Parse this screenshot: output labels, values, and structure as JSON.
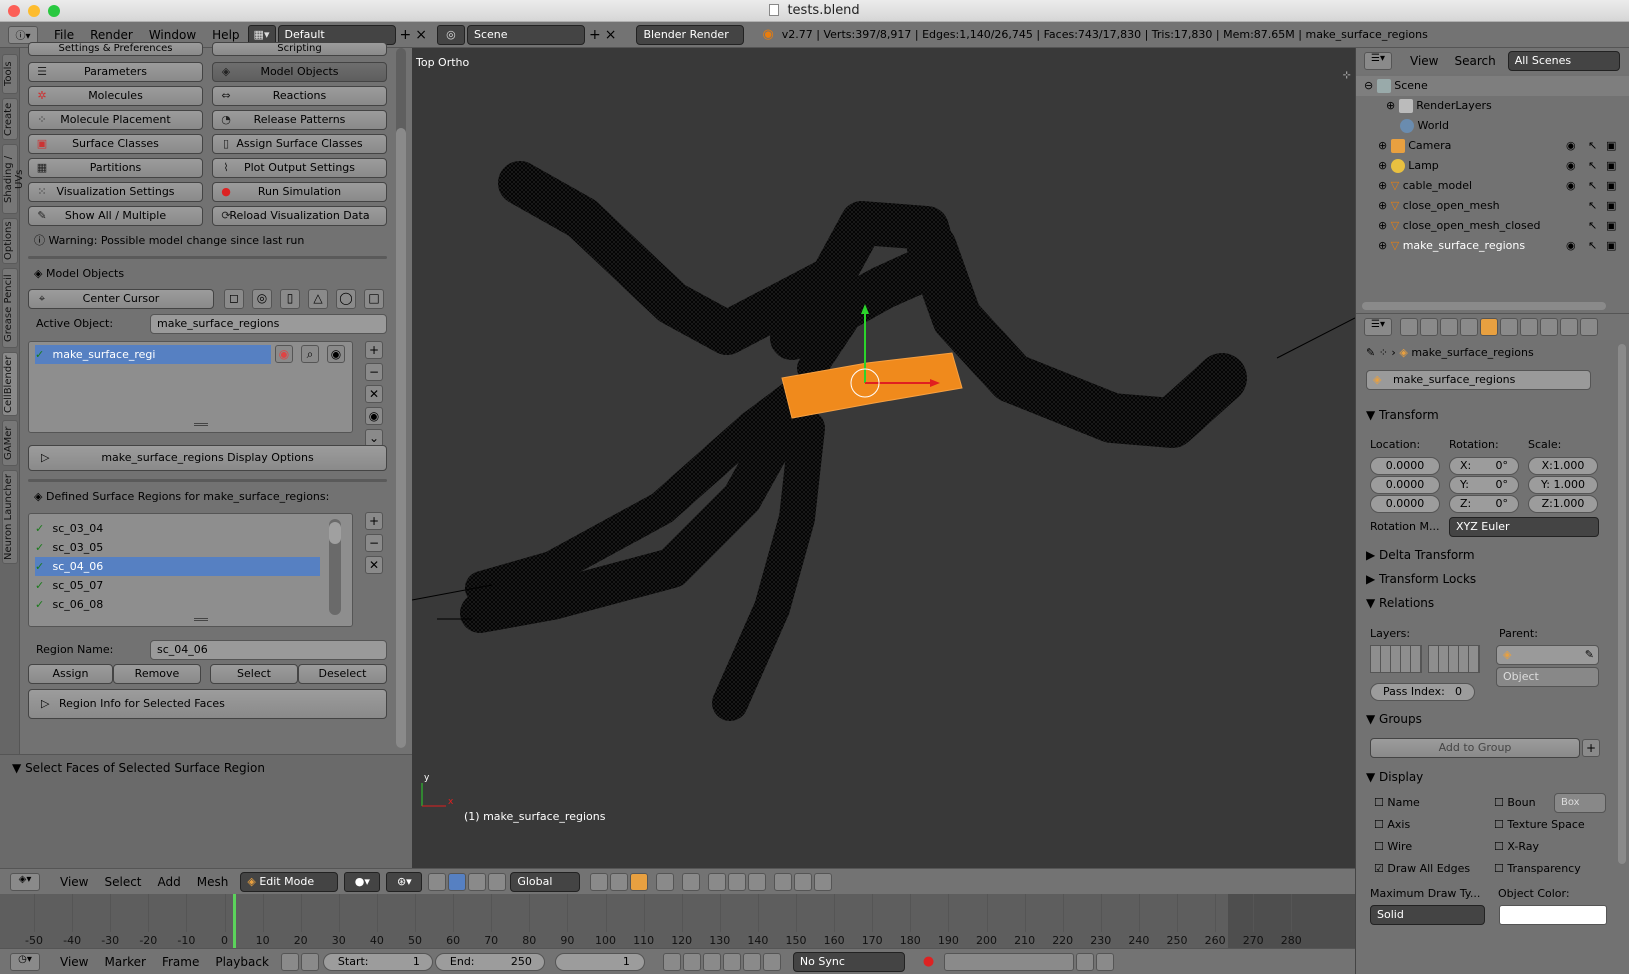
{
  "window": {
    "title": "tests.blend"
  },
  "topbar": {
    "menus": [
      "File",
      "Render",
      "Window",
      "Help"
    ],
    "layout": "Default",
    "scene": "Scene",
    "engine": "Blender Render",
    "stats": "v2.77 | Verts:397/8,917 | Edges:1,140/26,745 | Faces:743/17,830 | Tris:17,830 | Mem:87.65M | make_surface_regions"
  },
  "left": {
    "vtabs": [
      "Tools",
      "Create",
      "Shading / UVs",
      "Options",
      "Grease Pencil",
      "CellBlender",
      "GAMer",
      "Neuron Launcher"
    ],
    "partial_top": [
      "Settings & Preferences",
      "Scripting"
    ],
    "buttons_left": [
      "Parameters",
      "Molecules",
      "Molecule Placement",
      "Surface Classes",
      "Partitions",
      "Visualization Settings",
      "Show All / Multiple"
    ],
    "buttons_right": [
      "Model Objects",
      "Reactions",
      "Release Patterns",
      "Assign Surface Classes",
      "Plot Output Settings",
      "Run Simulation",
      "Reload Visualization Data"
    ],
    "warning": "Warning: Possible model change since last run",
    "model_objects_header": "Model Objects",
    "center_cursor": "Center Cursor",
    "active_object_label": "Active Object:",
    "active_object_value": "make_surface_regions",
    "object_list": [
      "make_surface_regi"
    ],
    "display_options": "make_surface_regions Display Options",
    "defined_regions_label": "Defined Surface Regions for make_surface_regions:",
    "regions": [
      "sc_03_04",
      "sc_03_05",
      "sc_04_06",
      "sc_05_07",
      "sc_06_08"
    ],
    "selected_region": "sc_04_06",
    "region_name_label": "Region Name:",
    "region_name_value": "sc_04_06",
    "region_buttons": [
      "Assign",
      "Remove",
      "Select",
      "Deselect"
    ],
    "region_info": "Region Info for Selected Faces",
    "operator_panel": "Select Faces of Selected Surface Region"
  },
  "viewport": {
    "view_label": "Top Ortho",
    "object_label": "(1) make_surface_regions",
    "colors": {
      "mesh": "#000000",
      "selection": "#f08a1c",
      "background": "#393939"
    }
  },
  "outliner": {
    "menus": [
      "View",
      "Search"
    ],
    "filter": "All Scenes",
    "items": [
      "Scene",
      "RenderLayers",
      "World",
      "Camera",
      "Lamp",
      "cable_model",
      "close_open_mesh",
      "close_open_mesh_closed",
      "make_surface_regions"
    ]
  },
  "properties": {
    "object_name": "make_surface_regions",
    "datablock": "make_surface_regions",
    "transform_header": "Transform",
    "location_label": "Location:",
    "rotation_label": "Rotation:",
    "scale_label": "Scale:",
    "location": [
      "0.0000",
      "0.0000",
      "0.0000"
    ],
    "rotation": [
      "X:",
      "0°",
      "Y:",
      "0°",
      "Z:",
      "0°"
    ],
    "scale": [
      "X:1.000",
      "Y: 1.000",
      "Z:1.000"
    ],
    "rotation_mode_label": "Rotation M...",
    "rotation_mode": "XYZ Euler",
    "delta_transform": "Delta Transform",
    "transform_locks": "Transform Locks",
    "relations": "Relations",
    "layers_label": "Layers:",
    "parent_label": "Parent:",
    "parent_type": "Object",
    "pass_index_label": "Pass Index:",
    "pass_index": "0",
    "groups": "Groups",
    "add_to_group": "Add to Group",
    "display": "Display",
    "display_checks": [
      "Name",
      "Axis",
      "Wire",
      "Draw All Edges"
    ],
    "display_checks_right": [
      "Boun",
      "Texture Space",
      "X-Ray",
      "Transparency"
    ],
    "bounds_type": "Box",
    "max_draw_label": "Maximum Draw Ty...",
    "object_color_label": "Object Color:",
    "max_draw_value": "Solid"
  },
  "view3d_header": {
    "menus": [
      "View",
      "Select",
      "Add",
      "Mesh"
    ],
    "mode": "Edit Mode",
    "orientation": "Global"
  },
  "timeline": {
    "ticks": [
      "-50",
      "-40",
      "-30",
      "-20",
      "-10",
      "0",
      "10",
      "20",
      "30",
      "40",
      "50",
      "60",
      "70",
      "80",
      "90",
      "100",
      "110",
      "120",
      "130",
      "140",
      "150",
      "160",
      "170",
      "180",
      "190",
      "200",
      "210",
      "220",
      "230",
      "240",
      "250",
      "260",
      "270",
      "280"
    ],
    "menus": [
      "View",
      "Marker",
      "Frame",
      "Playback"
    ],
    "start_label": "Start:",
    "start": "1",
    "end_label": "End:",
    "end": "250",
    "current": "1",
    "sync": "No Sync"
  }
}
